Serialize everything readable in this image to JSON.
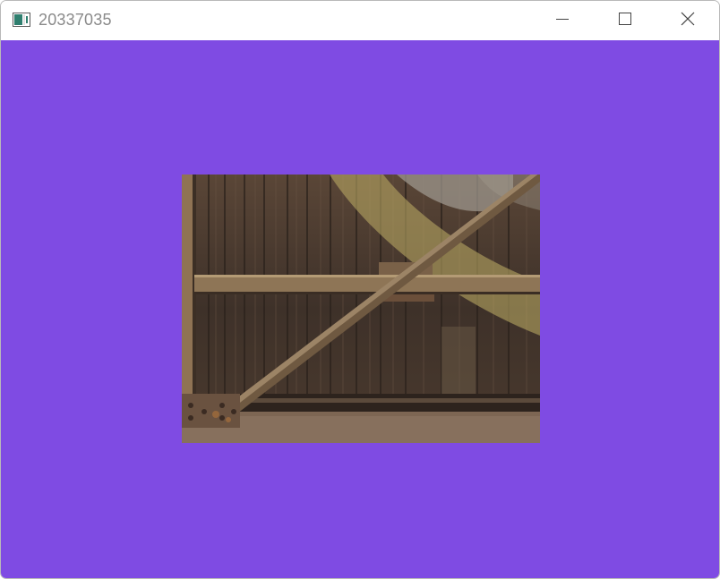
{
  "window": {
    "title": "20337035",
    "icon": "app-window-icon",
    "controls": [
      "minimize-icon",
      "maximize-icon",
      "close-icon"
    ]
  },
  "client": {
    "background_color": "#7f4be3",
    "texture": "wooden-crate-texture"
  }
}
